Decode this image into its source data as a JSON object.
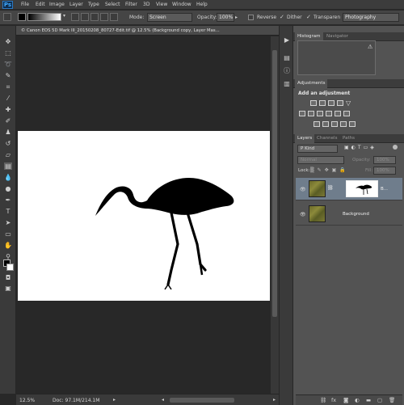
{
  "app": {
    "logo": "Ps"
  },
  "menu": [
    "File",
    "Edit",
    "Image",
    "Layer",
    "Type",
    "Select",
    "Filter",
    "3D",
    "View",
    "Window",
    "Help"
  ],
  "options": {
    "mode_label": "Mode:",
    "mode_value": "Screen",
    "opacity_label": "Opacity:",
    "opacity_value": "100%",
    "reverse_label": "Reverse",
    "dither_label": "Dither",
    "transparency_label": "Transparen",
    "preset_value": "Photography"
  },
  "document": {
    "tab_title": "© Canon EOS 5D Mark III_20150208_80727-Edit.tif @ 12.5% (Background copy, Layer Mas...",
    "zoom": "12.5%",
    "doc_size": "Doc: 97.1M/214.1M"
  },
  "panels": {
    "histogram_tabs": [
      "Histogram",
      "Navigator"
    ],
    "warning_icon": "⚠",
    "adjustments_tab": "Adjustments",
    "adjustments_title": "Add an adjustment",
    "layers_tabs": [
      "Layers",
      "Channels",
      "Paths"
    ],
    "filter_kind": "P Kind",
    "blend_mode": "Normal",
    "opacity_label": "Opacity:",
    "opacity_value": "100%",
    "lock_label": "Lock:",
    "fill_label": "Fill:",
    "fill_value": "100%",
    "layers": [
      {
        "name": "B...",
        "selected": true,
        "has_mask": true
      },
      {
        "name": "Background",
        "selected": false,
        "has_mask": false
      }
    ]
  },
  "colors": {
    "canvas": "#ffffff",
    "selected_layer": "#6f7d8c",
    "panel_bg": "#535353",
    "app_bg": "#282828"
  }
}
